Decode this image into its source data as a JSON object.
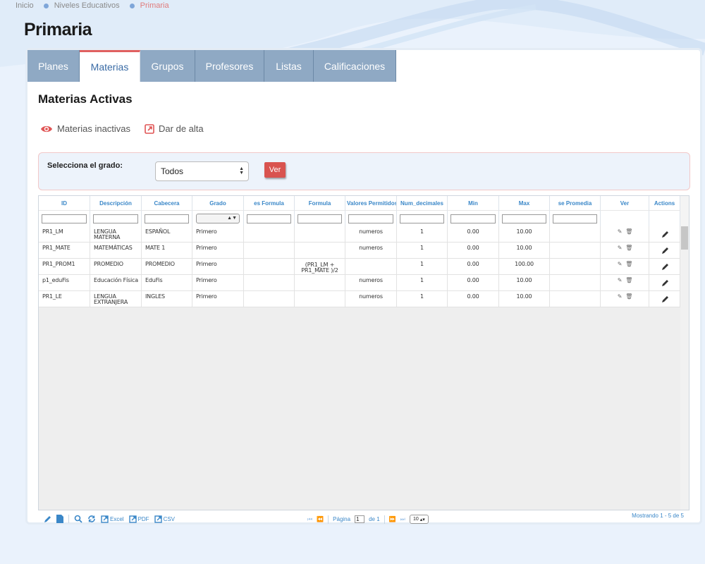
{
  "breadcrumb": {
    "items": [
      "Inicio",
      "Niveles Educativos",
      "Primaria"
    ]
  },
  "page": {
    "title": "Primaria"
  },
  "tabs": [
    {
      "label": "Planes",
      "active": false
    },
    {
      "label": "Materias",
      "active": true
    },
    {
      "label": "Grupos",
      "active": false
    },
    {
      "label": "Profesores",
      "active": false
    },
    {
      "label": "Listas",
      "active": false
    },
    {
      "label": "Calificaciones",
      "active": false
    }
  ],
  "section": {
    "title": "Materias Activas",
    "inactive_link": "Materias inactivas",
    "add_link": "Dar de alta"
  },
  "filter": {
    "label": "Selecciona el grado:",
    "selected": "Todos",
    "button": "Ver"
  },
  "grid": {
    "columns": [
      "ID",
      "Descripción",
      "Cabecera",
      "Grado",
      "es Formula",
      "Formula",
      "Valores Permitidos",
      "Num_decimales",
      "Min",
      "Max",
      "se Promedia",
      "Ver",
      "Actions"
    ],
    "rows": [
      {
        "id": "PR1_LM",
        "descripcion": "LENGUA MATERNA",
        "cabecera": "ESPAÑOL",
        "grado": "Primero",
        "es_formula": "",
        "formula": "",
        "valores": "numeros",
        "decimales": "1",
        "min": "0.00",
        "max": "10.00",
        "promedia": ""
      },
      {
        "id": "PR1_MATE",
        "descripcion": "MATEMÁTICAS",
        "cabecera": "MATE 1",
        "grado": "Primero",
        "es_formula": "",
        "formula": "",
        "valores": "numeros",
        "decimales": "1",
        "min": "0.00",
        "max": "10.00",
        "promedia": ""
      },
      {
        "id": "PR1_PROM1",
        "descripcion": "PROMEDIO",
        "cabecera": "PROMEDIO",
        "grado": "Primero",
        "es_formula": "",
        "formula": "(PR1_LM + PR1_MATE )/2",
        "valores": "",
        "decimales": "1",
        "min": "0.00",
        "max": "100.00",
        "promedia": ""
      },
      {
        "id": "p1_eduFis",
        "descripcion": "Educación Física",
        "cabecera": "EduFis",
        "grado": "Primero",
        "es_formula": "",
        "formula": "",
        "valores": "numeros",
        "decimales": "1",
        "min": "0.00",
        "max": "10.00",
        "promedia": ""
      },
      {
        "id": "PR1_LE",
        "descripcion": "LENGUA EXTRANJERA",
        "cabecera": "INGLES",
        "grado": "Primero",
        "es_formula": "",
        "formula": "",
        "valores": "numeros",
        "decimales": "1",
        "min": "0.00",
        "max": "10.00",
        "promedia": ""
      }
    ]
  },
  "pager": {
    "excel": "Excel",
    "pdf": "PDF",
    "csv": "CSV",
    "page_label": "Página",
    "page_value": "1",
    "of_label": "de 1",
    "rows_per_page": "10",
    "summary": "Mostrando 1 - 5 de 5"
  },
  "colors": {
    "accent_blue": "#3a87c8",
    "tab_bg": "#8fa9c4",
    "danger": "#d9534f"
  }
}
